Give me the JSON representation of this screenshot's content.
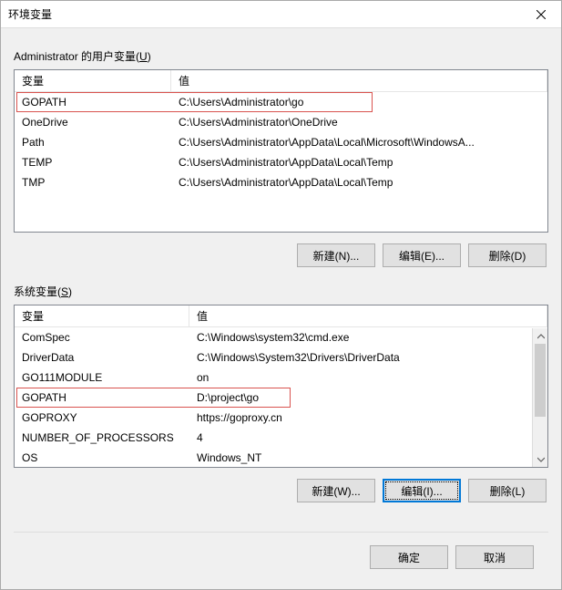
{
  "dialog": {
    "title": "环境变量"
  },
  "user_section": {
    "label_prefix": "Administrator 的用户变量(",
    "label_key": "U",
    "label_suffix": ")",
    "columns": {
      "var": "变量",
      "val": "值"
    },
    "rows": [
      {
        "name": "GOPATH",
        "value": "C:\\Users\\Administrator\\go"
      },
      {
        "name": "OneDrive",
        "value": "C:\\Users\\Administrator\\OneDrive"
      },
      {
        "name": "Path",
        "value": "C:\\Users\\Administrator\\AppData\\Local\\Microsoft\\WindowsA..."
      },
      {
        "name": "TEMP",
        "value": "C:\\Users\\Administrator\\AppData\\Local\\Temp"
      },
      {
        "name": "TMP",
        "value": "C:\\Users\\Administrator\\AppData\\Local\\Temp"
      }
    ],
    "buttons": {
      "new": "新建(N)...",
      "edit": "编辑(E)...",
      "delete": "删除(D)"
    }
  },
  "system_section": {
    "label_prefix": "系统变量(",
    "label_key": "S",
    "label_suffix": ")",
    "columns": {
      "var": "变量",
      "val": "值"
    },
    "rows": [
      {
        "name": "ComSpec",
        "value": "C:\\Windows\\system32\\cmd.exe"
      },
      {
        "name": "DriverData",
        "value": "C:\\Windows\\System32\\Drivers\\DriverData"
      },
      {
        "name": "GO111MODULE",
        "value": "on"
      },
      {
        "name": "GOPATH",
        "value": "D:\\project\\go"
      },
      {
        "name": "GOPROXY",
        "value": "https://goproxy.cn"
      },
      {
        "name": "NUMBER_OF_PROCESSORS",
        "value": "4"
      },
      {
        "name": "OS",
        "value": "Windows_NT"
      }
    ],
    "buttons": {
      "new": "新建(W)...",
      "edit": "编辑(I)...",
      "delete": "删除(L)"
    }
  },
  "footer": {
    "ok": "确定",
    "cancel": "取消"
  }
}
